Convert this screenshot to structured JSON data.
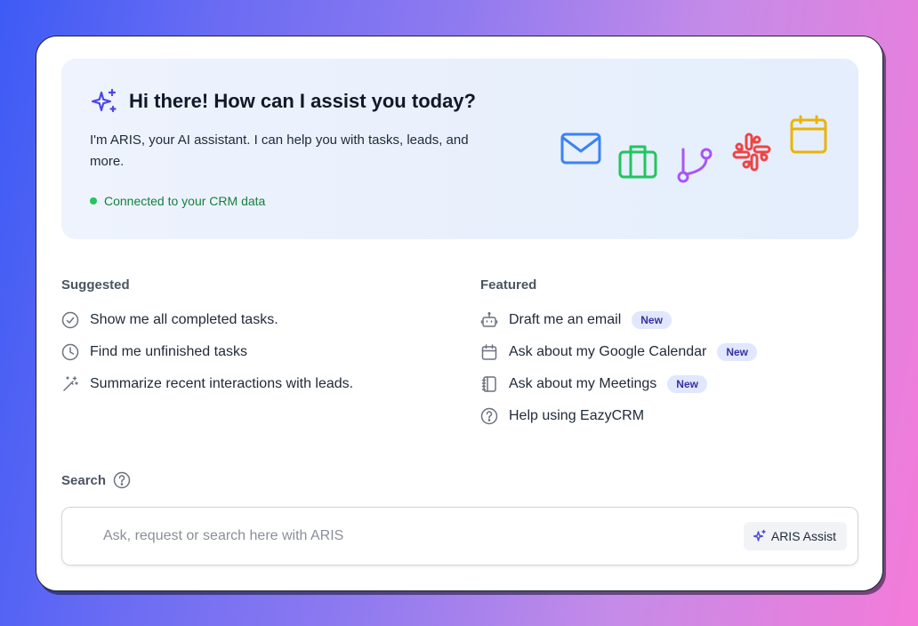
{
  "hero": {
    "title": "Hi there! How can I assist you today?",
    "description": "I'm ARIS, your AI assistant. I can help you with tasks, leads, and more.",
    "status": "Connected to your CRM data",
    "status_color": "#22c55e",
    "integration_icons": [
      "mail-icon",
      "briefcase-icon",
      "git-branch-icon",
      "slack-icon",
      "calendar-icon"
    ]
  },
  "suggested": {
    "title": "Suggested",
    "items": [
      {
        "label": "Show me all completed tasks.",
        "icon": "check-circle-icon"
      },
      {
        "label": "Find me unfinished tasks",
        "icon": "clock-icon"
      },
      {
        "label": "Summarize recent interactions with leads.",
        "icon": "magic-wand-icon"
      }
    ]
  },
  "featured": {
    "title": "Featured",
    "items": [
      {
        "label": "Draft me an email",
        "icon": "bot-icon",
        "badge": "New"
      },
      {
        "label": "Ask about my Google Calendar",
        "icon": "calendar-icon",
        "badge": "New"
      },
      {
        "label": "Ask about my Meetings",
        "icon": "notebook-icon",
        "badge": "New"
      },
      {
        "label": "Help using EazyCRM",
        "icon": "help-circle-icon"
      }
    ]
  },
  "search": {
    "label": "Search",
    "placeholder": "Ask, request or search here with ARIS",
    "value": "",
    "assist_button": "ARIS Assist"
  },
  "colors": {
    "accent": "#4f46e5",
    "badge_bg": "#e0e7ff",
    "badge_text": "#3730a3"
  }
}
